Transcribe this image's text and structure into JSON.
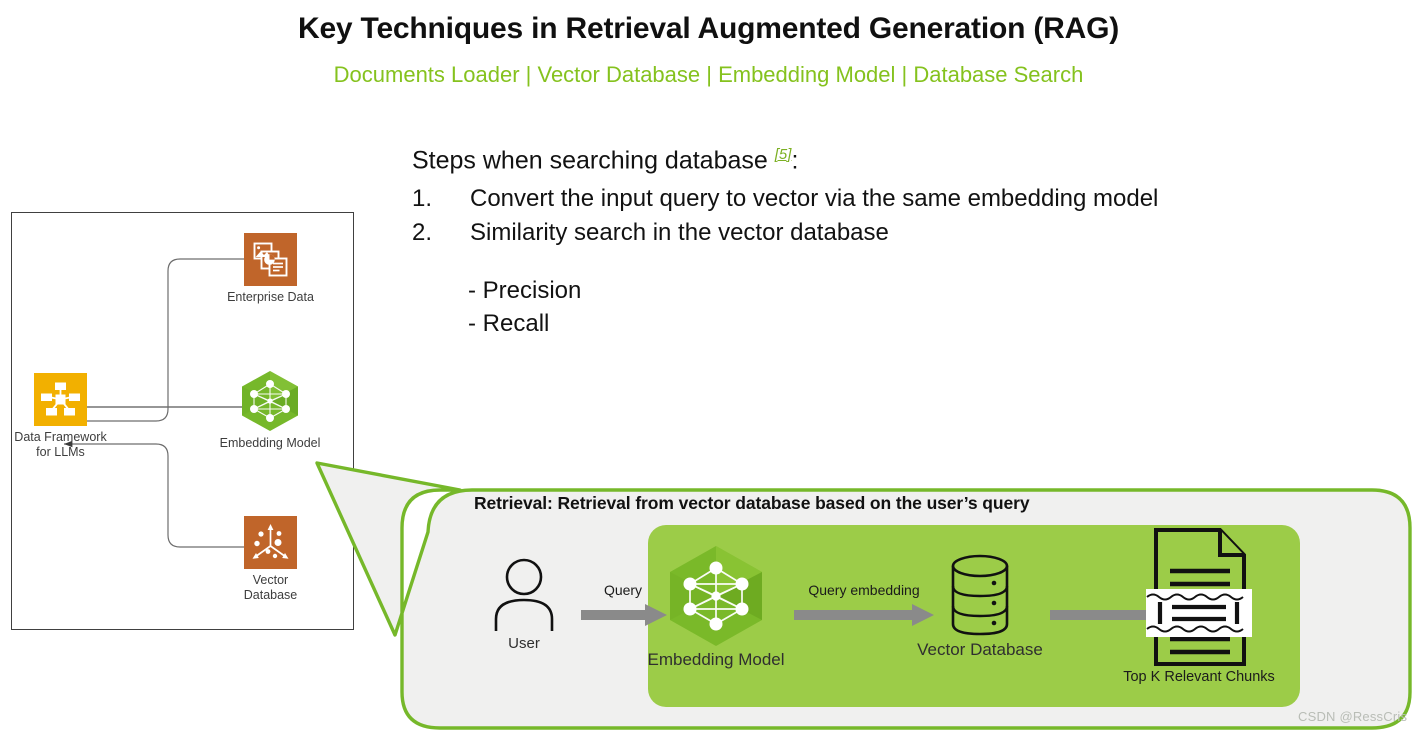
{
  "header": {
    "title": "Key Techniques in Retrieval Augmented Generation (RAG)",
    "subtitle": "Documents Loader | Vector Database | Embedding Model | Database Search",
    "title_color": "#101010",
    "subtitle_color": "#85c21e"
  },
  "left_panel": {
    "name": "data-framework-diagram",
    "nodes": [
      {
        "id": "enterprise-data",
        "label": "Enterprise Data",
        "icon": "documents-stack-icon",
        "color": "#c0652a"
      },
      {
        "id": "data-framework",
        "label": "Data Framework\nfor LLMs",
        "label_line1": "Data Framework",
        "label_line2": "for LLMs",
        "icon": "hub-network-icon",
        "color": "#f2b000"
      },
      {
        "id": "embedding-model",
        "label": "Embedding Model",
        "icon": "hexagon-neural-net-icon",
        "color": "#76b82a"
      },
      {
        "id": "vector-database",
        "label": "Vector\nDatabase",
        "label_line1": "Vector",
        "label_line2": "Database",
        "icon": "vector-axes-icon",
        "color": "#c0652a"
      }
    ]
  },
  "steps": {
    "heading": "Steps when searching database",
    "citation": "[5]",
    "heading_suffix": ":",
    "items": [
      {
        "num": "1.",
        "text": "Convert the input query to vector via the same embedding model"
      },
      {
        "num": "2.",
        "text": "Similarity search in the vector database"
      }
    ],
    "metrics": [
      {
        "text": "- Precision"
      },
      {
        "text": "- Recall"
      }
    ]
  },
  "callout": {
    "heading": "Retrieval: Retrieval from vector database based on the user’s query",
    "border_color": "#76b82a",
    "fill_color": "#f0f0ef",
    "panel_color": "#9ccc48",
    "pipeline": [
      {
        "id": "user",
        "label": "User",
        "icon": "user-person-icon"
      },
      {
        "id": "embedding-model",
        "label": "Embedding Model",
        "icon": "hexagon-neural-net-icon"
      },
      {
        "id": "vector-database",
        "label": "Vector Database",
        "icon": "database-cylinder-icon"
      },
      {
        "id": "top-k-chunks",
        "label": "Top K Relevant Chunks",
        "icon": "document-chunks-icon"
      }
    ],
    "arrows": [
      {
        "id": "query-arrow",
        "label": "Query"
      },
      {
        "id": "query-embedding-arrow",
        "label": "Query embedding"
      },
      {
        "id": "retrieve-arrow",
        "label": ""
      }
    ]
  },
  "watermark": {
    "text": "CSDN @RessCris"
  }
}
